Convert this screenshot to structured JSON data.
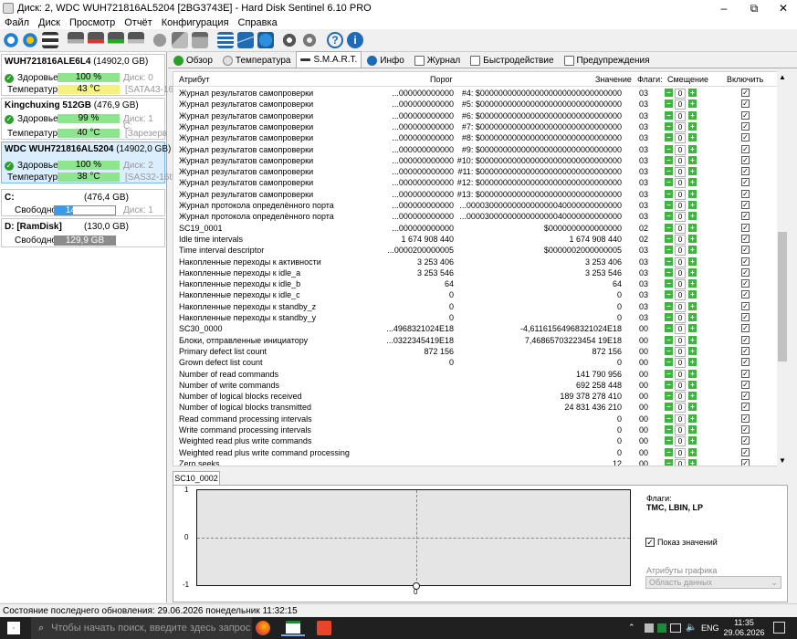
{
  "window": {
    "title": "Диск: 2, WDC    WUH721816AL5204 [2BG3743E]  -  Hard Disk Sentinel 6.10 PRO",
    "minimize": "–",
    "maximize": "⧉",
    "close": "✕"
  },
  "menu": [
    "Файл",
    "Диск",
    "Просмотр",
    "Отчёт",
    "Конфигурация",
    "Справка"
  ],
  "toolbar": {
    "icons": [
      "refresh-icon",
      "refresh-all-icon",
      "disk-list-icon",
      "disk-tool-icon",
      "disk-remove-icon",
      "disk-check-icon",
      "disk-scan-icon",
      "disk-test-icon",
      "disk-tools-icon",
      "disk-settings-icon",
      "report-icon",
      "email-icon",
      "web-report-icon",
      "settings-icon",
      "config-icon",
      "help-icon",
      "info-icon"
    ]
  },
  "disks": [
    {
      "name": "WUH721816ALE6L4",
      "size": "(14902,0 GB)",
      "health_label": "Здоровье:",
      "health": "100 %",
      "disk_no": "Диск: 0",
      "temp_label": "Температура:",
      "temp": "43 °C",
      "iface": "[SATA43-16t",
      "selected": false
    },
    {
      "name": "Kingchuxing 512GB",
      "size": "(476,9 GB)",
      "health_label": "Здоровье:",
      "health": "99 %",
      "disk_no": "Диск: 1",
      "disk_extra": "C:",
      "temp_label": "Температура:",
      "temp": "40 °C",
      "iface": "[Зарезерв",
      "selected": false
    },
    {
      "name": "WDC    WUH721816AL5204",
      "size": "(14902,0 GB)",
      "health_label": "Здоровье:",
      "health": "100 %",
      "disk_no": "Диск: 2",
      "temp_label": "Температура:",
      "temp": "38 °C",
      "iface": "[SAS32-16tb",
      "selected": true
    }
  ],
  "volumes": [
    {
      "letter": "C:",
      "size": "(476,4 GB)",
      "free_label": "Свободно",
      "free": "148,3 GB",
      "disk": "Диск: 1",
      "fill": 0.31
    },
    {
      "letter": "D: [RamDisk]",
      "size": "(130,0 GB)",
      "free_label": "Свободно",
      "free": "129,9 GB",
      "disk": "",
      "fill": 1.0
    }
  ],
  "tabs": [
    "Обзор",
    "Температура",
    "S.M.A.R.T.",
    "Инфо",
    "Журнал",
    "Быстродействие",
    "Предупреждения"
  ],
  "active_tab": "S.M.A.R.T.",
  "table": {
    "headers": {
      "attr": "Атрибут",
      "threshold": "Порог",
      "value": "Значение",
      "flags": "Флаги:",
      "offset": "Смещение",
      "enable": "Включить"
    },
    "rows": [
      {
        "name": "Журнал результатов самопроверки",
        "th": "...000000000000",
        "val": "#4: $0000000000000000000000000000000",
        "fl": "03"
      },
      {
        "name": "Журнал результатов самопроверки",
        "th": "...000000000000",
        "val": "#5: $0000000000000000000000000000000",
        "fl": "03"
      },
      {
        "name": "Журнал результатов самопроверки",
        "th": "...000000000000",
        "val": "#6: $0000000000000000000000000000000",
        "fl": "03"
      },
      {
        "name": "Журнал результатов самопроверки",
        "th": "...000000000000",
        "val": "#7: $0000000000000000000000000000000",
        "fl": "03"
      },
      {
        "name": "Журнал результатов самопроверки",
        "th": "...000000000000",
        "val": "#8: $0000000000000000000000000000000",
        "fl": "03"
      },
      {
        "name": "Журнал результатов самопроверки",
        "th": "...000000000000",
        "val": "#9: $0000000000000000000000000000000",
        "fl": "03"
      },
      {
        "name": "Журнал результатов самопроверки",
        "th": "...000000000000",
        "val": "#10: $0000000000000000000000000000000",
        "fl": "03"
      },
      {
        "name": "Журнал результатов самопроверки",
        "th": "...000000000000",
        "val": "#11: $0000000000000000000000000000000",
        "fl": "03"
      },
      {
        "name": "Журнал результатов самопроверки",
        "th": "...000000000000",
        "val": "#12: $0000000000000000000000000000000",
        "fl": "03"
      },
      {
        "name": "Журнал результатов самопроверки",
        "th": "...000000000000",
        "val": "#13: $0000000000000000000000000000000",
        "fl": "03"
      },
      {
        "name": "Журнал протокола определённого порта",
        "th": "...000000000000",
        "val": "...0000300000000000000040000000000000",
        "fl": "03"
      },
      {
        "name": "Журнал протокола определённого порта",
        "th": "...000000000000",
        "val": "...0000300000000000000040000000000000",
        "fl": "03"
      },
      {
        "name": "SC19_0001",
        "th": "...000000000000",
        "val": "$0000000000000000",
        "fl": "02"
      },
      {
        "name": "Idle time intervals",
        "th": "1 674 908 440",
        "val": "1 674 908 440",
        "fl": "02"
      },
      {
        "name": "Time interval descriptor",
        "th": "...0000200000005",
        "val": "$0000002000000005",
        "fl": "03"
      },
      {
        "name": "Накопленные переходы к активности",
        "th": "3 253 406",
        "val": "3 253 406",
        "fl": "03"
      },
      {
        "name": "Накопленные переходы к idle_a",
        "th": "3 253 546",
        "val": "3 253 546",
        "fl": "03"
      },
      {
        "name": "Накопленные переходы к idle_b",
        "th": "64",
        "val": "64",
        "fl": "03"
      },
      {
        "name": "Накопленные переходы к idle_c",
        "th": "0",
        "val": "0",
        "fl": "03"
      },
      {
        "name": "Накопленные переходы к standby_z",
        "th": "0",
        "val": "0",
        "fl": "03"
      },
      {
        "name": "Накопленные переходы к standby_y",
        "th": "0",
        "val": "0",
        "fl": "03"
      },
      {
        "name": "SC30_0000",
        "th": "...4968321024E18",
        "val": "-4,61161564968321024E18",
        "fl": "00"
      },
      {
        "name": "Блоки, отправленные инициатору",
        "th": "...0322345419E18",
        "val": "7,46865703223454 19E18",
        "fl": "00"
      },
      {
        "name": "Primary defect list count",
        "th": "872 156",
        "val": "872 156",
        "fl": "00"
      },
      {
        "name": "Grown defect list count",
        "th": "0",
        "val": "0",
        "fl": "00"
      },
      {
        "name": "Number of read commands",
        "th": "",
        "val": "141 790 956",
        "fl": "00"
      },
      {
        "name": "Number of write commands",
        "th": "",
        "val": "692 258 448",
        "fl": "00"
      },
      {
        "name": "Number of logical blocks received",
        "th": "",
        "val": "189 378 278 410",
        "fl": "00"
      },
      {
        "name": "Number of logical blocks transmitted",
        "th": "",
        "val": "24 831 436 210",
        "fl": "00"
      },
      {
        "name": "Read command processing intervals",
        "th": "",
        "val": "0",
        "fl": "00"
      },
      {
        "name": "Write command processing intervals",
        "th": "",
        "val": "0",
        "fl": "00"
      },
      {
        "name": "Weighted read plus write commands",
        "th": "",
        "val": "0",
        "fl": "00"
      },
      {
        "name": "Weighted read plus write command processing",
        "th": "",
        "val": "0",
        "fl": "00"
      },
      {
        "name": "Zero seeks",
        "th": "",
        "val": "12",
        "fl": "00"
      }
    ]
  },
  "graph": {
    "tab": "SC10_0002",
    "y_ticks": [
      "1",
      "0",
      "-1"
    ],
    "x_tick": "0",
    "flags_label": "Флаги:",
    "flags_value": "TMC, LBIN, LP",
    "show_values": "Показ значений",
    "attrs_label": "Атрибуты графика",
    "attrs_select": "Область данных"
  },
  "status": "Состояние последнего обновления: 29.06.2026 понедельник 11:32:15",
  "taskbar": {
    "search_placeholder": "Чтобы начать поиск, введите здесь запрос",
    "lang": "ENG",
    "time": "11:35",
    "date": "29.06.2026"
  }
}
